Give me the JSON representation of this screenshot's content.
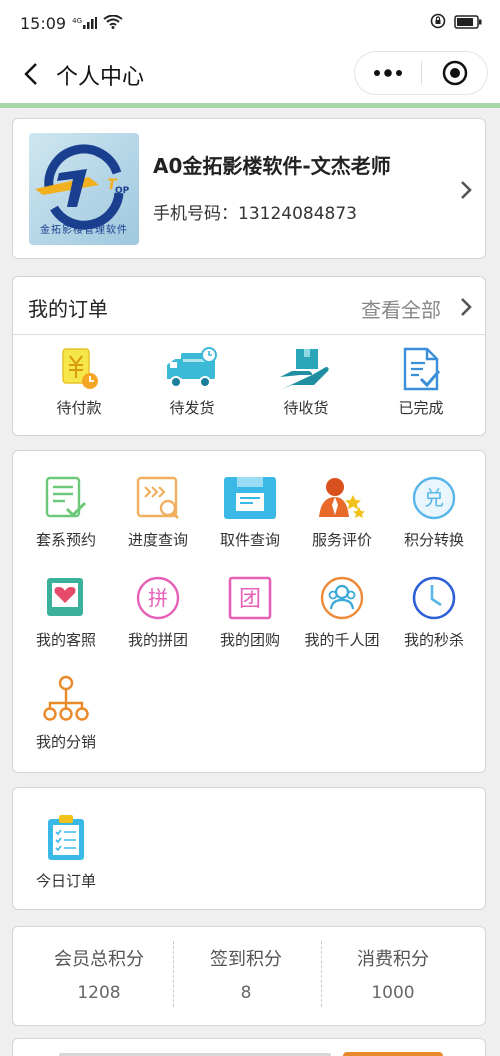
{
  "status_bar": {
    "time": "15:09",
    "net": "4G"
  },
  "nav": {
    "title": "个人中心"
  },
  "profile": {
    "name": "A0金拓影楼软件-文杰老师",
    "phone_label": "手机号码：",
    "phone": "13124084873",
    "logo_text": "金拓影楼管理软件",
    "logo_mark": "JTOP"
  },
  "orders": {
    "title": "我的订单",
    "view_all": "查看全部",
    "items": [
      {
        "label": "待付款",
        "icon": "yuan-clock-icon"
      },
      {
        "label": "待发货",
        "icon": "truck-icon"
      },
      {
        "label": "待收货",
        "icon": "hand-box-icon"
      },
      {
        "label": "已完成",
        "icon": "document-check-icon"
      }
    ]
  },
  "services": [
    {
      "label": "套系预约",
      "icon": "list-check-icon"
    },
    {
      "label": "进度查询",
      "icon": "progress-search-icon"
    },
    {
      "label": "取件查询",
      "icon": "package-card-icon"
    },
    {
      "label": "服务评价",
      "icon": "person-stars-icon"
    },
    {
      "label": "积分转换",
      "icon": "exchange-icon",
      "glyph": "兑"
    },
    {
      "label": "我的客照",
      "icon": "photo-heart-icon"
    },
    {
      "label": "我的拼团",
      "icon": "group-buy-icon",
      "glyph": "拼"
    },
    {
      "label": "我的团购",
      "icon": "team-buy-icon",
      "glyph": "团"
    },
    {
      "label": "我的千人团",
      "icon": "people-group-icon"
    },
    {
      "label": "我的秒杀",
      "icon": "clock-icon"
    },
    {
      "label": "我的分销",
      "icon": "distribution-tree-icon"
    }
  ],
  "today": {
    "label": "今日订单",
    "icon": "clipboard-icon"
  },
  "points": [
    {
      "title": "会员总积分",
      "value": "1208"
    },
    {
      "title": "签到积分",
      "value": "8"
    },
    {
      "title": "消费积分",
      "value": "1000"
    }
  ],
  "colors": {
    "accent_green": "#a8d8a8",
    "orange": "#e88a2a",
    "teal": "#3bb9d6",
    "pink": "#e660b8"
  }
}
